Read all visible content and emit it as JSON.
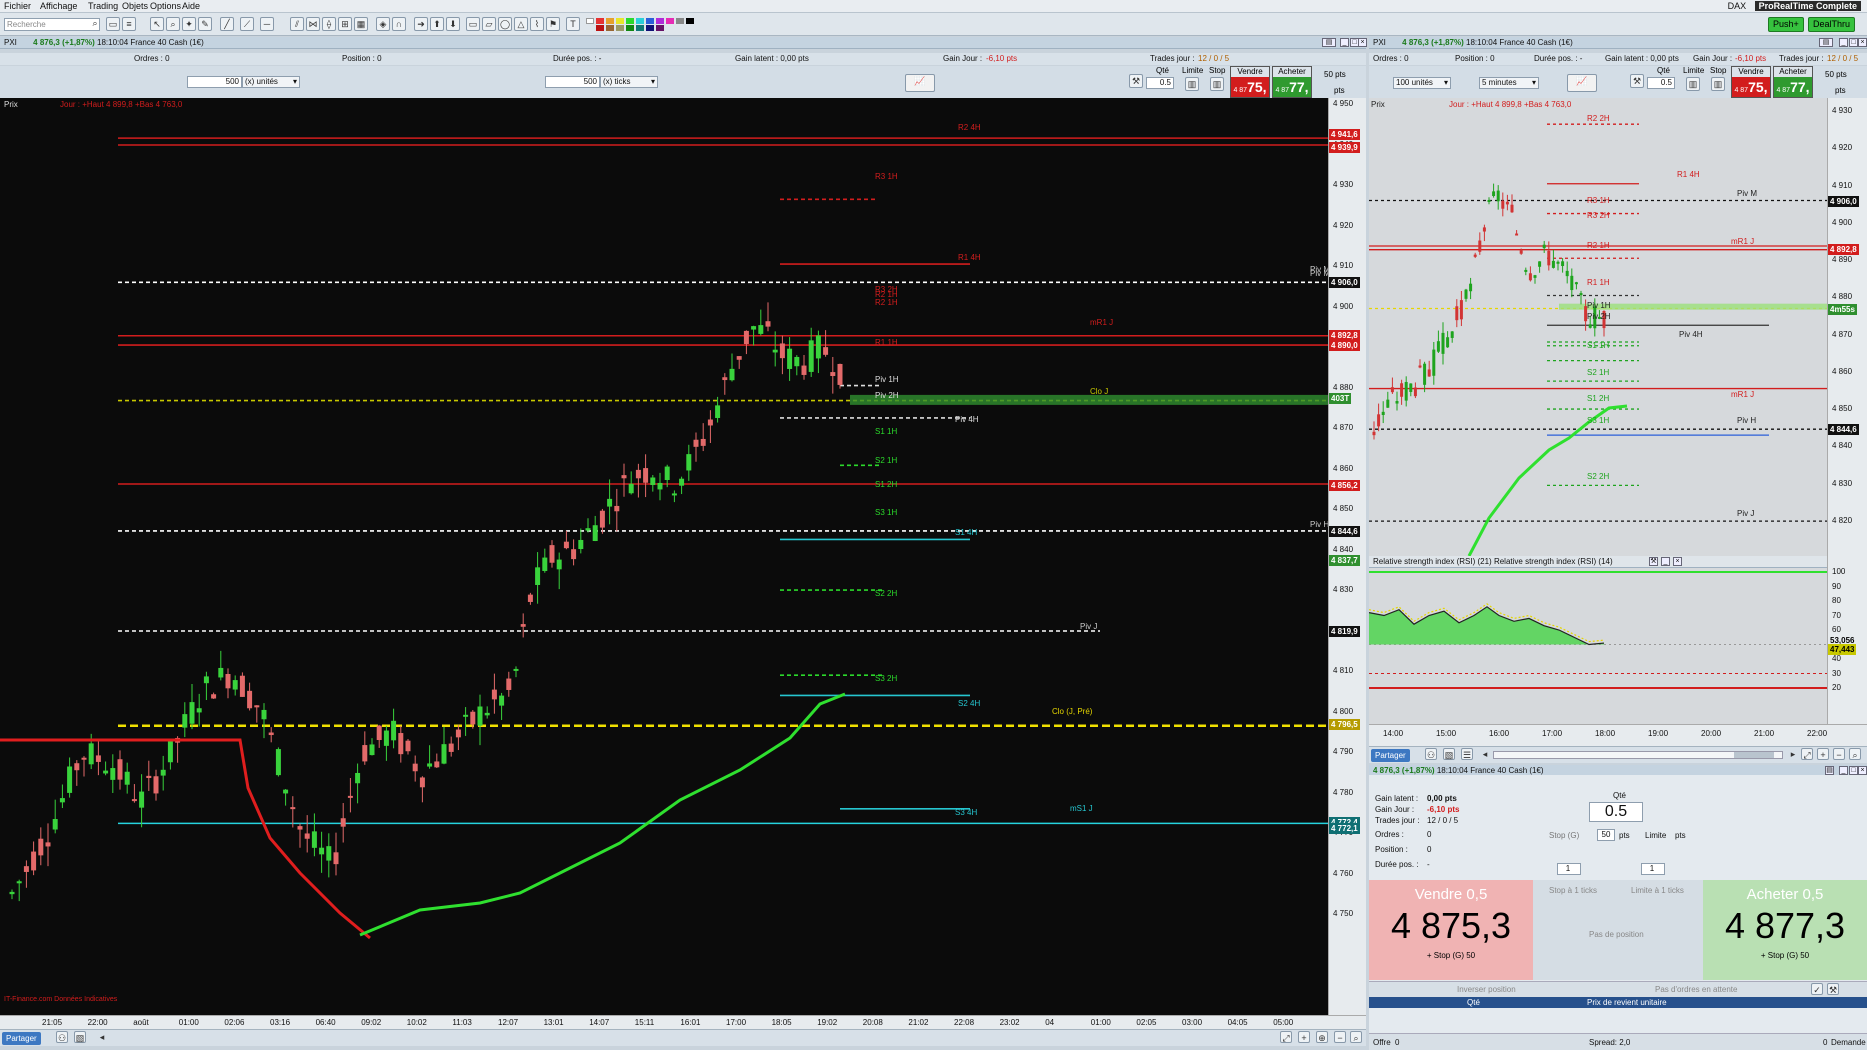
{
  "menu": [
    "Fichier",
    "Affichage",
    "Trading",
    "Objets",
    "Options",
    "Aide"
  ],
  "header_right": {
    "index": "DAX",
    "product": "ProRealTime Complete"
  },
  "toolbar": {
    "search_placeholder": "Recherche",
    "push_label": "Push+",
    "dealthru_label": "DealThru"
  },
  "instrument": {
    "name": "PXI",
    "price": "4 876,3",
    "change": "(+1,87%)",
    "time": "18:10:04",
    "desc": "France 40 Cash (1€)"
  },
  "left": {
    "info": {
      "ordres": "Ordres : 0",
      "position": "Position : 0",
      "duree": "Durée pos. : -",
      "gain_latent": "Gain latent : 0,00 pts",
      "gain_jour_label": "Gain Jour :",
      "gain_jour": "-6,10 pts",
      "trades_label": "Trades jour :",
      "trades": "12 / 0 / 5"
    },
    "qty1": "500",
    "unit1": "(x) unités",
    "qty2": "500",
    "unit2": "(x) ticks",
    "qte_label": "Qté",
    "qte": "0.5",
    "limite": "Limite",
    "stop": "Stop",
    "vendre": "Vendre",
    "acheter": "Acheter",
    "sell_small": "4 87",
    "sell_big": "75,",
    "buy_small": "4 87",
    "buy_big": "77,",
    "pts": "50 pts",
    "pts_val": "pts",
    "legend": "Prix",
    "legend2": "Jour : +Haut 4 899,8 +Bas 4 763,0",
    "yticks": [
      "4 950",
      "4 940",
      "4 930",
      "4 920",
      "4 910",
      "4 900",
      "4 890",
      "4 880",
      "4 870",
      "4 860",
      "4 850",
      "4 840",
      "4 830",
      "4 820",
      "4 810",
      "4 800",
      "4 790",
      "4 780",
      "4 770",
      "4 760",
      "4 750"
    ],
    "xticks": [
      "21:05",
      "22:00",
      "août",
      "01:00",
      "02:06",
      "03:16",
      "06:40",
      "09:02",
      "10:02",
      "11:03",
      "12:07",
      "13:01",
      "14:07",
      "15:11",
      "16:01",
      "17:00",
      "18:05",
      "19:02",
      "20:08",
      "21:02",
      "22:08",
      "23:02",
      "04",
      "01:00",
      "02:05",
      "03:00",
      "04:05",
      "05:00"
    ],
    "tags": [
      {
        "text": "4 941,6",
        "bg": "#d21d1d"
      },
      {
        "text": "4 939,9",
        "bg": "#d21d1d"
      },
      {
        "text": "4 906,0",
        "bg": "#111111"
      },
      {
        "text": "4 892,8",
        "bg": "#d21d1d"
      },
      {
        "text": "4 890,0",
        "bg": "#d21d1d"
      },
      {
        "text": "403T",
        "bg": "#2f8f2f"
      },
      {
        "text": "4 856,2",
        "bg": "#d21d1d"
      },
      {
        "text": "4 844,6",
        "bg": "#111111"
      },
      {
        "text": "4 837,7",
        "bg": "#2f8f2f"
      },
      {
        "text": "4 819,9",
        "bg": "#111111"
      },
      {
        "text": "4 796,5",
        "bg": "#b59b00"
      },
      {
        "text": "4 772,4",
        "bg": "#0f6f73"
      },
      {
        "text": "4 772,1",
        "bg": "#0f6f73"
      }
    ],
    "levels": [
      {
        "text": "R2 4H",
        "color": "#d21d1d"
      },
      {
        "text": "R3 1H",
        "color": "#d21d1d"
      },
      {
        "text": "R1 4H",
        "color": "#d21d1d"
      },
      {
        "text": "Piv M",
        "color": "#cccccc"
      },
      {
        "text": "R3 2H",
        "color": "#d21d1d"
      },
      {
        "text": "R2 1H",
        "color": "#d21d1d"
      },
      {
        "text": "mR1 J",
        "color": "#d21d1d"
      },
      {
        "text": "R1 1H",
        "color": "#d21d1d"
      },
      {
        "text": "Piv 1H",
        "color": "#dddddd"
      },
      {
        "text": "Piv 2H",
        "color": "#dddddd"
      },
      {
        "text": "Clo J",
        "color": "#c8c800"
      },
      {
        "text": "Piv 4H",
        "color": "#dddddd"
      },
      {
        "text": "S1 1H",
        "color": "#2bd92b"
      },
      {
        "text": "S2 1H",
        "color": "#2bd92b"
      },
      {
        "text": "S1 2H",
        "color": "#2bd92b"
      },
      {
        "text": "S3 1H",
        "color": "#2bd92b"
      },
      {
        "text": "S2 2H",
        "color": "#2bd92b"
      },
      {
        "text": "Piv J",
        "color": "#cccccc"
      },
      {
        "text": "S3 2H",
        "color": "#2bd92b"
      },
      {
        "text": "S2 4H",
        "color": "#26c6d0"
      },
      {
        "text": "Clo (J, Pré)",
        "color": "#e6d600"
      },
      {
        "text": "S3 4H",
        "color": "#26c6d0"
      },
      {
        "text": "mS1 J",
        "color": "#26c6d0"
      },
      {
        "text": "Piv H",
        "color": "#cccccc"
      },
      {
        "text": "R2 1H",
        "color": "#d21d1d"
      },
      {
        "text": "Piv M",
        "color": "#cccccc"
      },
      {
        "text": "S1 4H",
        "color": "#26c6d0"
      }
    ],
    "footer_label": "IT-Finance.com Données Indicatives",
    "partager": "Partager"
  },
  "right": {
    "info": {
      "ordres": "Ordres : 0",
      "position": "Position : 0",
      "duree": "Durée pos. : -",
      "gain_latent": "Gain latent : 0,00 pts",
      "gain_jour_label": "Gain Jour :",
      "gain_jour": "-6,10 pts",
      "trades_label": "Trades jour :",
      "trades": "12 / 0 / 5"
    },
    "units": "100 unités",
    "timeframe": "5 minutes",
    "legend": "Prix",
    "legend2": "Jour : +Haut 4 899,8 +Bas 4 763,0",
    "yticks": [
      "4 930",
      "4 920",
      "4 910",
      "4 900",
      "4 890",
      "4 880",
      "4 870",
      "4 860",
      "4 850",
      "4 840",
      "4 830",
      "4 820"
    ],
    "tags": [
      {
        "text": "4 906,0",
        "bg": "#111111"
      },
      {
        "text": "4 892,8",
        "bg": "#d21d1d"
      },
      {
        "text": "4m55s",
        "bg": "#2f8f2f"
      },
      {
        "text": "4 844,6",
        "bg": "#111111"
      }
    ],
    "levels": [
      {
        "text": "R2 2H",
        "color": "#d21d1d"
      },
      {
        "text": "R1 4H",
        "color": "#d21d1d"
      },
      {
        "text": "R3 1H",
        "color": "#d21d1d"
      },
      {
        "text": "R3 2H",
        "color": "#d21d1d"
      },
      {
        "text": "R2 1H",
        "color": "#d21d1d"
      },
      {
        "text": "Piv M",
        "color": "#222222"
      },
      {
        "text": "mR1 J",
        "color": "#d21d1d"
      },
      {
        "text": "R1 1H",
        "color": "#d21d1d"
      },
      {
        "text": "Piv 1H",
        "color": "#222222"
      },
      {
        "text": "Piv 2H",
        "color": "#222222"
      },
      {
        "text": "Piv 4H",
        "color": "#222222"
      },
      {
        "text": "S1 1H",
        "color": "#1ea41e"
      },
      {
        "text": "S2 1H",
        "color": "#1ea41e"
      },
      {
        "text": "S1 2H",
        "color": "#1ea41e"
      },
      {
        "text": "mR1 J",
        "color": "#d21d1d"
      },
      {
        "text": "S3 1H",
        "color": "#1ea41e"
      },
      {
        "text": "Piv H",
        "color": "#222222"
      },
      {
        "text": "S2 2H",
        "color": "#1ea41e"
      },
      {
        "text": "Piv J",
        "color": "#222222"
      }
    ],
    "rsi_title": "Relative strength index (RSI) (21) Relative strength index (RSI) (14)",
    "rsi_yticks": [
      "100",
      "90",
      "80",
      "70",
      "60",
      "50",
      "40",
      "30",
      "20"
    ],
    "rsi_tags": [
      {
        "text": "53,056",
        "bg": "#e7ebee"
      },
      {
        "text": "47,443",
        "bg": "#c8c800"
      }
    ],
    "xticks": [
      "14:00",
      "15:00",
      "16:00",
      "17:00",
      "18:00",
      "19:00",
      "20:00",
      "21:00",
      "22:00"
    ],
    "partager": "Partager"
  },
  "trade": {
    "title_price": "4 876,3 (+1,87%)",
    "title_time": "18:10:04",
    "title_desc": "France 40 Cash (1€)",
    "gain_latent_label": "Gain latent :",
    "gain_latent": "0,00 pts",
    "gain_jour_label": "Gain Jour :",
    "gain_jour": "-6,10 pts",
    "trades_label": "Trades jour :",
    "trades": "12 / 0 / 5",
    "ordres_label": "Ordres :",
    "ordres": "0",
    "position_label": "Position :",
    "position": "0",
    "duree_label": "Durée pos. :",
    "duree": "-",
    "qte_label": "Qté",
    "qte": "0.5",
    "stop_label": "Stop (G)",
    "stop_val": "50",
    "pts": "pts",
    "limite_label": "Limite",
    "limite_pts": "pts",
    "step1": "1",
    "step2": "1",
    "stop_ticks": "Stop à 1 ticks",
    "limite_ticks": "Limite à 1 ticks",
    "sell_title": "Vendre 0,5",
    "sell_price": "4 875,3",
    "sell_sub": "+ Stop (G) 50",
    "buy_title": "Acheter 0,5",
    "buy_price": "4 877,3",
    "buy_sub": "+ Stop (G) 50",
    "no_position": "Pas de position",
    "invert": "Inverser position",
    "no_orders": "Pas d'ordres en attente",
    "col_qty": "Qté",
    "col_price": "Prix de revient unitaire",
    "offre_label": "Offre",
    "offre": "0",
    "spread": "Spread: 2,0",
    "demande_label": "Demande",
    "demande": "0"
  }
}
